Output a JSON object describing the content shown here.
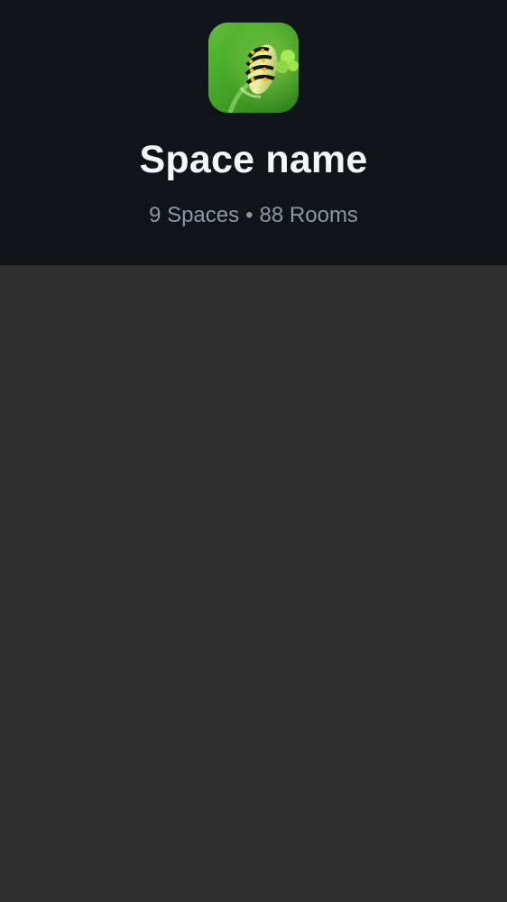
{
  "space": {
    "name": "Space name",
    "spaces_count": "9 Spaces",
    "separator": "•",
    "rooms_count": "88 Rooms"
  },
  "icons": {
    "avatar": "caterpillar-photo-avatar"
  },
  "colors": {
    "header_background": "#101419",
    "content_background": "#2f2f2f",
    "title_text": "#f5f7fa",
    "meta_text": "#8d97a5"
  }
}
